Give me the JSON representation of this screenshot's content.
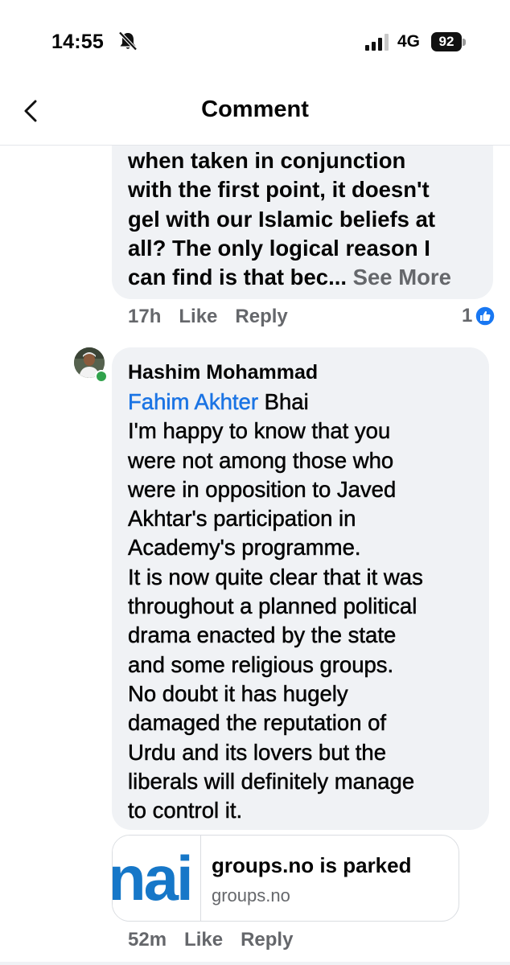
{
  "status": {
    "time": "14:55",
    "network": "4G",
    "battery": "92"
  },
  "header": {
    "title": "Comment"
  },
  "previous_comment": {
    "text": "when taken in conjunction\nwith the first point, it doesn't\ngel with our Islamic beliefs at\nall? The only logical reason I\ncan find is that bec... ",
    "see_more": "See More",
    "time": "17h",
    "like_label": "Like",
    "reply_label": "Reply",
    "reaction_count": "1"
  },
  "reply_comment": {
    "author": "Hashim Mohammad",
    "mention": "Fahim Akhter",
    "after_mention": " Bhai",
    "text": " I'm happy to know that you\nwere not among those who\nwere in opposition to Javed\nAkhtar's participation in\nAcademy's programme.\nIt is now quite clear that it was\nthroughout a planned political\ndrama enacted by the state\nand some religious groups.\nNo doubt it has hugely\ndamaged the reputation of\nUrdu and its lovers but the\nliberals will definitely manage\nto control it.",
    "time": "52m",
    "like_label": "Like",
    "reply_label": "Reply"
  },
  "link_preview": {
    "thumb_text": "nai",
    "title": "groups.no is parked",
    "domain": "groups.no"
  },
  "colors": {
    "link_blue": "#1b74e4",
    "bubble_bg": "#f0f2f5",
    "meta_gray": "#65676b",
    "online_green": "#31a24c"
  }
}
